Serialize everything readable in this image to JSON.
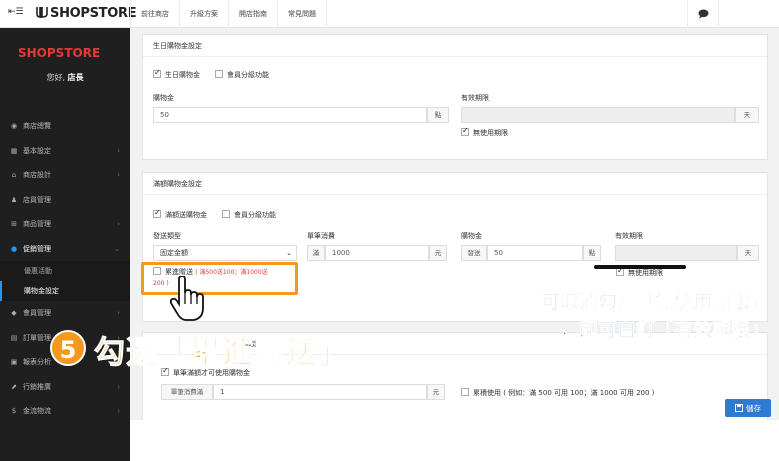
{
  "topbar": {
    "menu_icon": "☰",
    "logo": "SHOPSTORE",
    "nav": [
      "前往商店",
      "升級方案",
      "開店指南",
      "常見問題"
    ],
    "chat_icon": "chat-bubble-icon"
  },
  "sidebar": {
    "logo": "SHOPSTORE",
    "greeting_prefix": "您好, ",
    "greeting_name": "店長",
    "items": [
      {
        "label": "商店總覽",
        "icon": "◉"
      },
      {
        "label": "基本設定",
        "icon": "▦"
      },
      {
        "label": "商店設計",
        "icon": "⌂"
      },
      {
        "label": "店員管理",
        "icon": "♟"
      },
      {
        "label": "商品管理",
        "icon": "⊞"
      },
      {
        "label": "促銷管理",
        "icon": "●"
      },
      {
        "label": "優惠活動"
      },
      {
        "label": "購物金設定"
      },
      {
        "label": "會員管理",
        "icon": "◆"
      },
      {
        "label": "訂單管理",
        "icon": "▤"
      },
      {
        "label": "報表分析",
        "icon": "▣"
      },
      {
        "label": "行銷推廣",
        "icon": "⬈"
      },
      {
        "label": "金流物流",
        "icon": "$"
      }
    ]
  },
  "birthday": {
    "title": "生日購物金設定",
    "enable_label": "生日購物金",
    "member_level_label": "會員分級功能",
    "amount_label": "購物金",
    "amount_value": "50",
    "amount_unit": "點",
    "validity_label": "有效期限",
    "validity_unit": "天",
    "unlimited_label": "無使用期限"
  },
  "threshold": {
    "title": "滿額購物金設定",
    "enable_label": "滿額送購物金",
    "member_level_label": "會員分級功能",
    "type_label": "發送類型",
    "type_value": "固定金額",
    "min_label": "單筆消費",
    "min_prefix": "滿",
    "min_value": "1000",
    "min_unit": "元",
    "amount_label": "購物金",
    "amount_prefix": "發送",
    "amount_value": "50",
    "amount_unit": "點",
    "validity_label": "有效期限",
    "validity_unit": "天",
    "unlimited_label": "無使用期限",
    "progressive_label": "累進贈送",
    "progressive_example": "( 滿500送100；滿1000送",
    "progressive_example_2": "200 )"
  },
  "usage": {
    "title_partial": "設定",
    "single_limit_label": "單筆滿額才可使用購物金",
    "min_spend_prefix": "單筆消費滿",
    "min_spend_value": "1",
    "min_spend_unit": "元",
    "stack_label": "累積使用 ( 例如：滿 500 可用 100；滿 1000 可用 200 )"
  },
  "save_label": "儲存",
  "annotations": {
    "step_number": "5",
    "step_text": "勾選「累進贈送」",
    "note_line1": "可取消勾選「無使用期限」",
    "note_line2": "，即可自訂「有效期限」"
  },
  "colors": {
    "accent_orange": "#f39a1e",
    "note_blue": "#1e88e5",
    "brand_red": "#e53935",
    "save_blue": "#2e7ad1"
  }
}
